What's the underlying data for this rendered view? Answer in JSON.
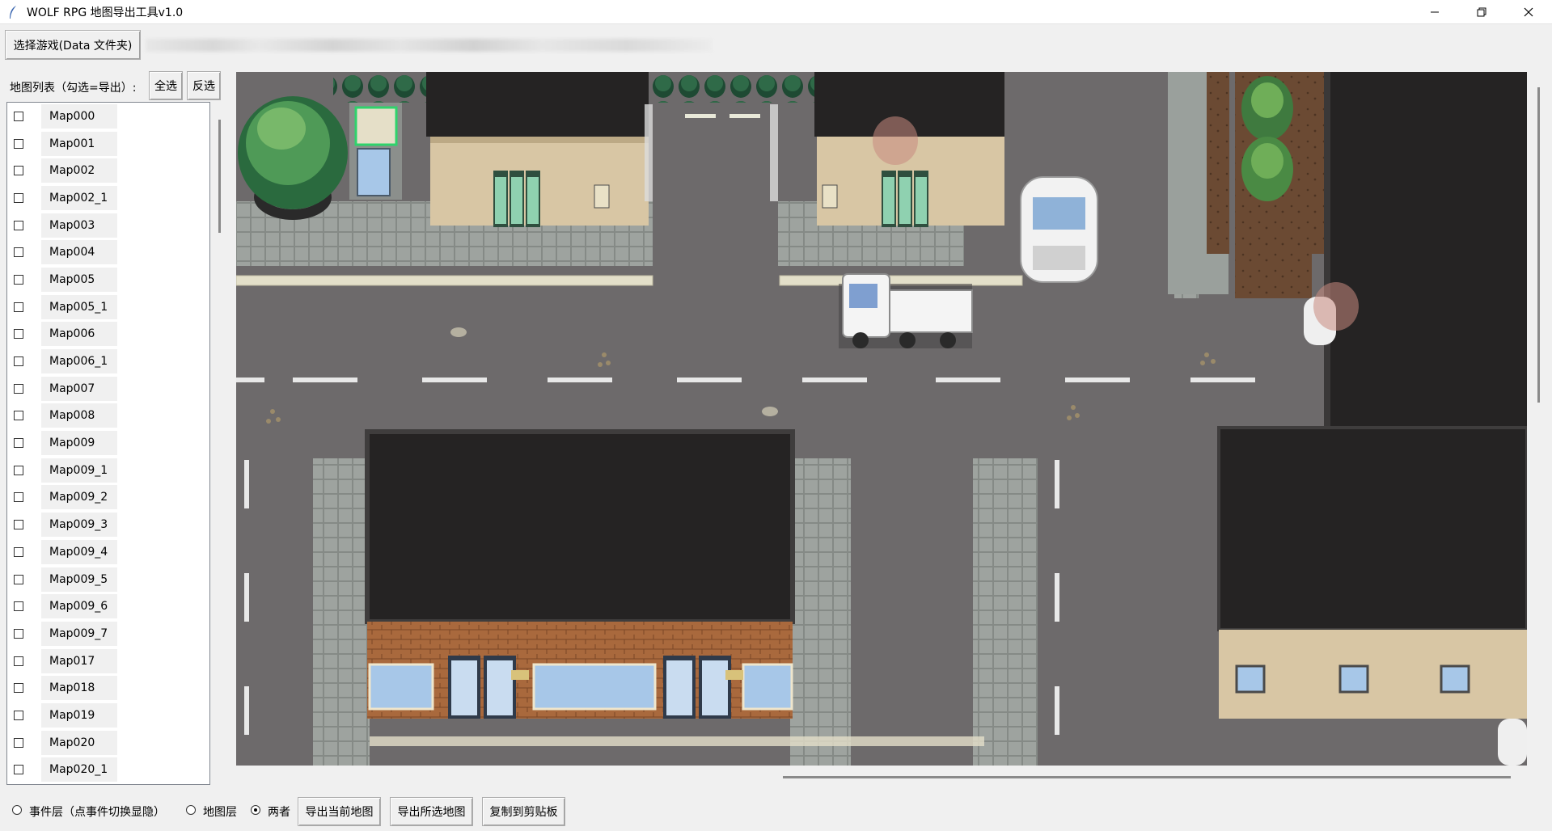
{
  "window": {
    "title": "WOLF RPG 地图导出工具v1.0"
  },
  "toolbar": {
    "select_game_label": "选择游戏(Data 文件夹)"
  },
  "list_panel": {
    "title": "地图列表（勾选=导出）:",
    "select_all_label": "全选",
    "invert_label": "反选",
    "items": [
      {
        "label": "Map000"
      },
      {
        "label": "Map001"
      },
      {
        "label": "Map002"
      },
      {
        "label": "Map002_1"
      },
      {
        "label": "Map003"
      },
      {
        "label": "Map004"
      },
      {
        "label": "Map005"
      },
      {
        "label": "Map005_1"
      },
      {
        "label": "Map006"
      },
      {
        "label": "Map006_1"
      },
      {
        "label": "Map007"
      },
      {
        "label": "Map008"
      },
      {
        "label": "Map009"
      },
      {
        "label": "Map009_1"
      },
      {
        "label": "Map009_2"
      },
      {
        "label": "Map009_3"
      },
      {
        "label": "Map009_4"
      },
      {
        "label": "Map009_5"
      },
      {
        "label": "Map009_6"
      },
      {
        "label": "Map009_7"
      },
      {
        "label": "Map017"
      },
      {
        "label": "Map018"
      },
      {
        "label": "Map019"
      },
      {
        "label": "Map020"
      },
      {
        "label": "Map020_1"
      }
    ]
  },
  "bottom": {
    "layer_event_label": "事件层（点事件切换显隐）",
    "layer_map_label": "地图层",
    "layer_both_label": "两者",
    "selected_layer": "两者",
    "export_current_label": "导出当前地图",
    "export_selected_label": "导出所选地图",
    "copy_clipboard_label": "复制到剪贴板"
  },
  "colors": {
    "road": "#6d6a6b",
    "building_roof": "#252323",
    "sidewalk": "#9aa09c",
    "wall_beige": "#d9c7a6",
    "brick": "#a8683c",
    "accent_green": "#2fd36c"
  }
}
